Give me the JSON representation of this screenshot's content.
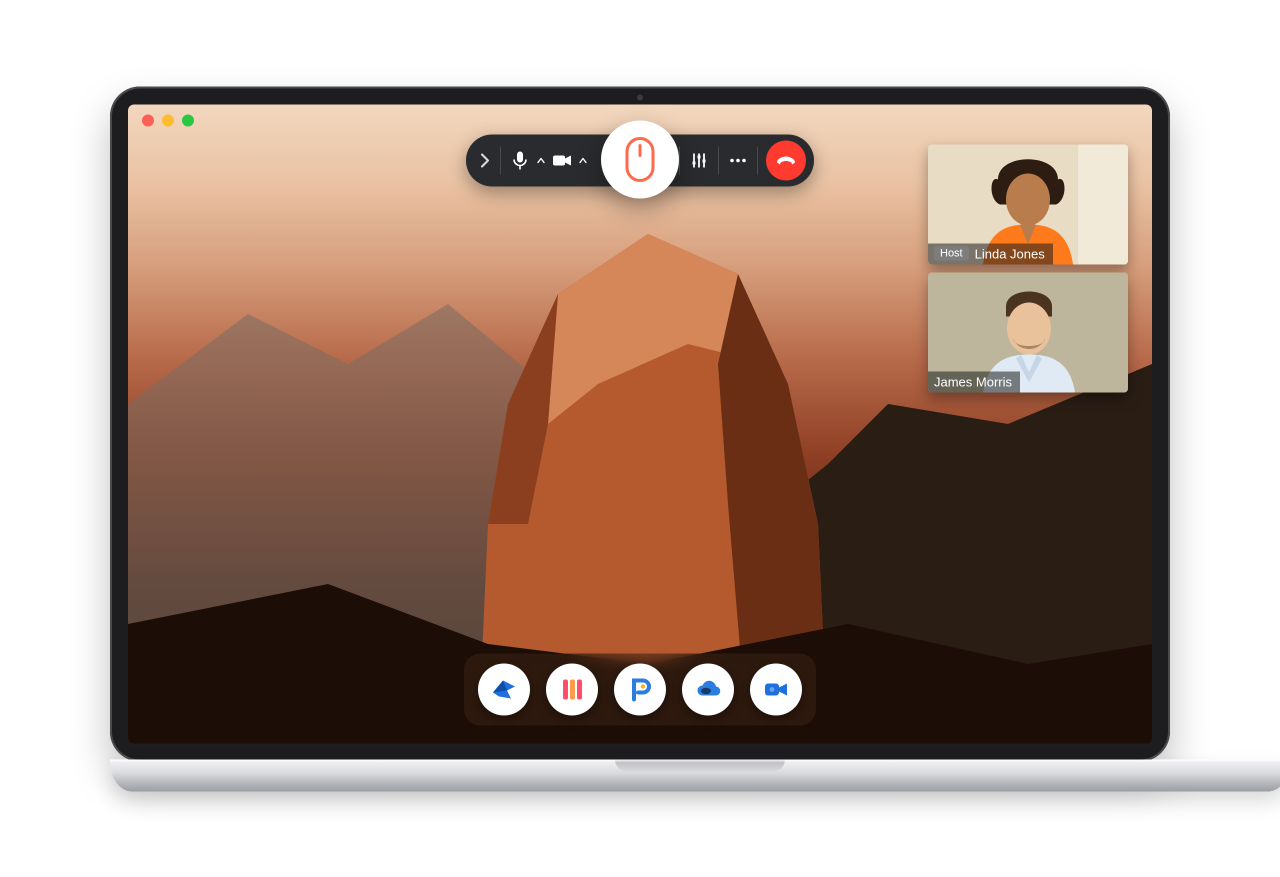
{
  "window": {
    "traffic_lights": [
      "close",
      "minimize",
      "zoom"
    ]
  },
  "meeting_toolbar": {
    "expand_icon": "chevron-right",
    "items": [
      {
        "name": "microphone",
        "has_caret": true
      },
      {
        "name": "camera",
        "has_caret": true
      },
      {
        "name": "remote-control-mouse",
        "central": true
      },
      {
        "name": "settings-sliders"
      },
      {
        "name": "more-options"
      },
      {
        "name": "hang-up",
        "style": "danger"
      }
    ]
  },
  "participants": [
    {
      "name": "Linda Jones",
      "host": true,
      "host_label": "Host"
    },
    {
      "name": "James Morris",
      "host": false
    }
  ],
  "dock": {
    "apps": [
      {
        "name": "mail",
        "icon": "mail-bird-icon",
        "color": "#1f6fde"
      },
      {
        "name": "boards",
        "icon": "columns-icon",
        "color": "#ff6a4d"
      },
      {
        "name": "projects",
        "icon": "p-logo-icon",
        "color": "#2b7de0"
      },
      {
        "name": "drive",
        "icon": "cloud-icon",
        "color": "#2b7de0"
      },
      {
        "name": "meeting",
        "icon": "video-camera-icon",
        "color": "#1f6fde"
      }
    ]
  },
  "colors": {
    "toolbar_bg": "#2a2b2e",
    "danger": "#ff3b30",
    "accent": "#ff6a4d"
  }
}
